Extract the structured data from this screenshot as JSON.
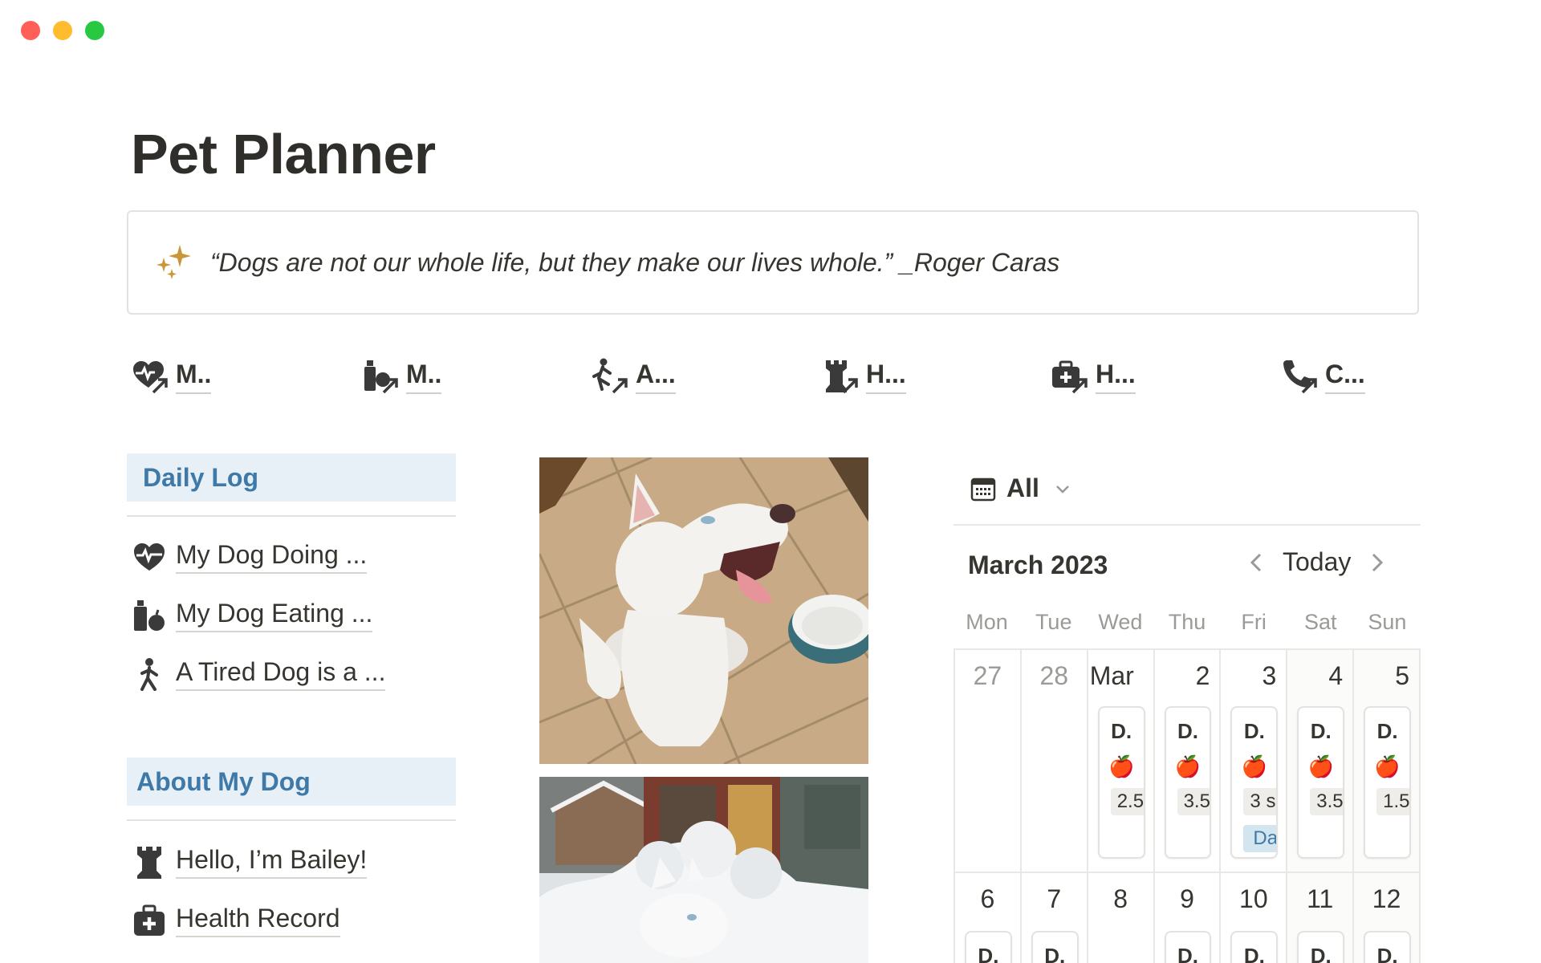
{
  "page": {
    "title": "Pet Planner"
  },
  "quote": {
    "text": "“Dogs are not our whole life, but they make our lives whole.” _Roger Caras",
    "icon": "sparkles-icon"
  },
  "quick_links": [
    {
      "label": "M..",
      "icon": "heart-pulse-arrow-icon"
    },
    {
      "label": "M..",
      "icon": "food-arrow-icon"
    },
    {
      "label": "A...",
      "icon": "walker-arrow-icon"
    },
    {
      "label": "H...",
      "icon": "castle-arrow-icon"
    },
    {
      "label": "H...",
      "icon": "medkit-arrow-icon"
    },
    {
      "label": "C...",
      "icon": "phone-arrow-icon"
    }
  ],
  "daily_log": {
    "heading": "Daily Log",
    "items": [
      {
        "label": "My Dog Doing ...",
        "icon": "heart-pulse-icon"
      },
      {
        "label": "My Dog Eating ...",
        "icon": "food-icon"
      },
      {
        "label": "A Tired Dog is a ...",
        "icon": "walker-icon"
      }
    ]
  },
  "about": {
    "heading": "About My Dog",
    "items": [
      {
        "label": "Hello, I’m Bailey!",
        "icon": "castle-icon"
      },
      {
        "label": "Health Record",
        "icon": "medkit-icon"
      }
    ]
  },
  "calendar": {
    "filter_label": "All",
    "month": "March 2023",
    "today_label": "Today",
    "weekdays": [
      "Mon",
      "Tue",
      "Wed",
      "Thu",
      "Fri",
      "Sat",
      "Sun"
    ],
    "week1": [
      {
        "day": "27",
        "muted": true
      },
      {
        "day": "28",
        "muted": true
      },
      {
        "day": "Mar",
        "card": {
          "title": "D.",
          "emoji": "🍎",
          "value": "2.5"
        }
      },
      {
        "day": "2",
        "card": {
          "title": "D.",
          "emoji": "🍎",
          "value": "3.5"
        }
      },
      {
        "day": "3",
        "card": {
          "title": "D.",
          "emoji": "🍎",
          "value": "3 s",
          "tag": "Da"
        }
      },
      {
        "day": "4",
        "card": {
          "title": "D.",
          "emoji": "🍎",
          "value": "3.5"
        }
      },
      {
        "day": "5",
        "card": {
          "title": "D.",
          "emoji": "🍎",
          "value": "1.5"
        }
      }
    ],
    "week2": [
      {
        "day": "6",
        "card": {
          "title": "D."
        }
      },
      {
        "day": "7",
        "card": {
          "title": "D."
        }
      },
      {
        "day": "8"
      },
      {
        "day": "9",
        "card": {
          "title": "D."
        }
      },
      {
        "day": "10",
        "card": {
          "title": "D."
        }
      },
      {
        "day": "11",
        "card": {
          "title": "D."
        }
      },
      {
        "day": "12",
        "card": {
          "title": "D."
        }
      }
    ]
  },
  "colors": {
    "accent_blue": "#3f79a8",
    "section_bg": "#e7f0f7",
    "gold": "#c9973a"
  }
}
